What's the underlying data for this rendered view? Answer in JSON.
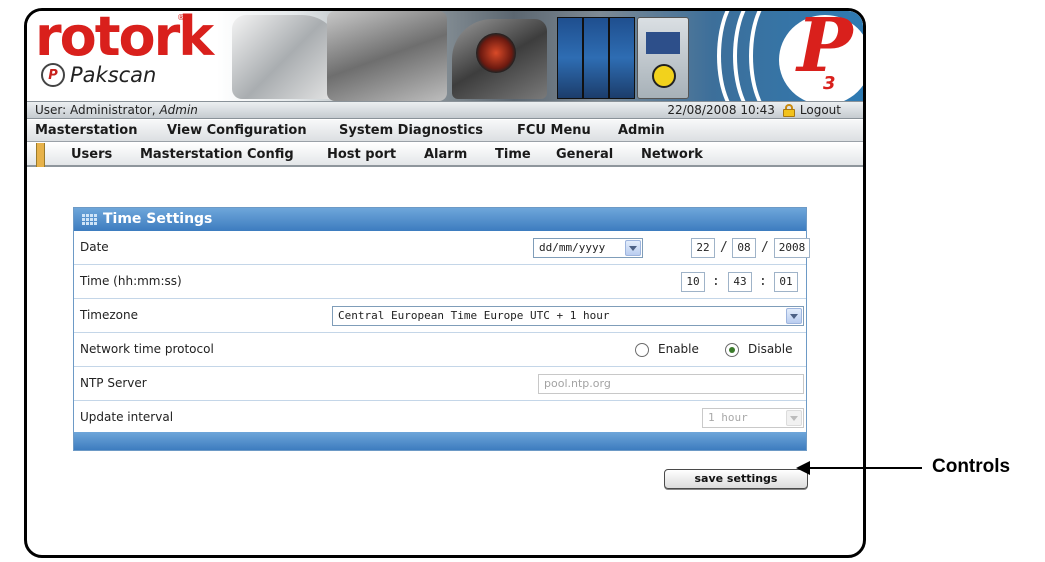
{
  "brand": {
    "logo_text": "rotork",
    "product_name": "Pakscan",
    "product_badge_letter": "P",
    "model_letter": "P",
    "model_number": "3"
  },
  "userbar": {
    "user_prefix": "User: Administrator, ",
    "user_role": "Admin",
    "datetime": "22/08/2008 10:43",
    "logout_label": "Logout"
  },
  "main_nav": [
    "Masterstation",
    "View Configuration",
    "System Diagnostics",
    "FCU Menu",
    "Admin"
  ],
  "sub_nav": [
    "Users",
    "Masterstation Config",
    "Host port",
    "Alarm",
    "Time",
    "General",
    "Network"
  ],
  "time_settings": {
    "title": "Time Settings",
    "date_label": "Date",
    "date_format": "dd/mm/yyyy",
    "date_day": "22",
    "date_month": "08",
    "date_year": "2008",
    "date_sep": "/",
    "time_label": "Time (hh:mm:ss)",
    "time_h": "10",
    "time_m": "43",
    "time_s": "01",
    "time_sep": ":",
    "timezone_label": "Timezone",
    "timezone_value": "Central European Time Europe UTC + 1 hour",
    "ntp_label": "Network time protocol",
    "ntp_enable_label": "Enable",
    "ntp_disable_label": "Disable",
    "ntp_selected": "Disable",
    "ntp_server_label": "NTP Server",
    "ntp_server_placeholder": "pool.ntp.org",
    "update_interval_label": "Update interval",
    "update_interval_value": "1 hour"
  },
  "save_button_label": "save settings",
  "callout_label": "Controls"
}
